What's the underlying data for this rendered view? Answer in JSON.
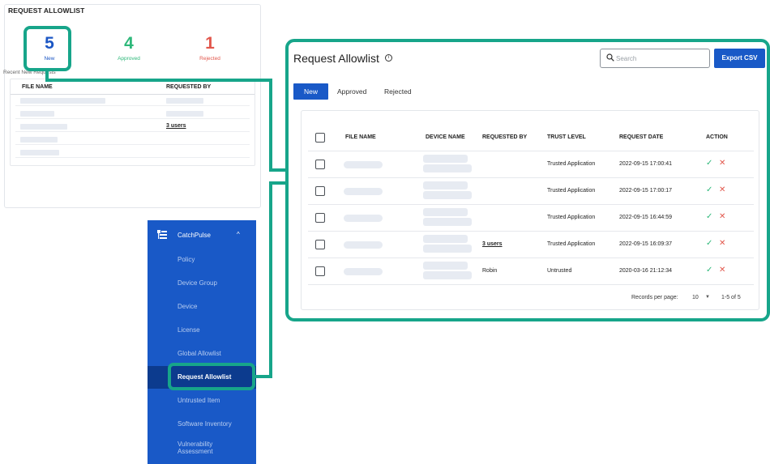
{
  "widget": {
    "title": "REQUEST ALLOWLIST",
    "stats": [
      {
        "count": "5",
        "label": "New"
      },
      {
        "count": "4",
        "label": "Approved"
      },
      {
        "count": "1",
        "label": "Rejected"
      }
    ],
    "recent_title": "Recent New Requests",
    "columns": [
      "FILE NAME",
      "REQUESTED BY"
    ],
    "row3_requested_by": "3 users"
  },
  "sidebar": {
    "header": "CatchPulse",
    "items": [
      {
        "label": "Policy"
      },
      {
        "label": "Device Group"
      },
      {
        "label": "Device"
      },
      {
        "label": "License"
      },
      {
        "label": "Global Allowlist"
      },
      {
        "label": "Request Allowlist"
      },
      {
        "label": "Untrusted Item"
      },
      {
        "label": "Software Inventory"
      },
      {
        "label": "Vulnerability Assessment"
      }
    ],
    "active_index": 5
  },
  "main": {
    "title": "Request Allowlist",
    "info_glyph": "i",
    "search_placeholder": "Search",
    "export_label": "Export CSV",
    "tabs": [
      "New",
      "Approved",
      "Rejected"
    ],
    "active_tab": "New",
    "columns": [
      "FILE NAME",
      "DEVICE NAME",
      "REQUESTED BY",
      "TRUST LEVEL",
      "REQUEST DATE",
      "ACTION"
    ],
    "rows": [
      {
        "requested_by": "",
        "trust_level": "Trusted Application",
        "request_date": "2022-09-15 17:00:41"
      },
      {
        "requested_by": "",
        "trust_level": "Trusted Application",
        "request_date": "2022-09-15 17:00:17"
      },
      {
        "requested_by": "",
        "trust_level": "Trusted Application",
        "request_date": "2022-09-15 16:44:59"
      },
      {
        "requested_by": "3 users",
        "trust_level": "Trusted Application",
        "request_date": "2022-09-15 16:09:37"
      },
      {
        "requested_by": "Robin",
        "trust_level": "Untrusted",
        "request_date": "2020-03-16 21:12:34"
      }
    ],
    "approve_glyph": "✓",
    "reject_glyph": "✕",
    "records_per_page_label": "Records per page:",
    "records_per_page": "10",
    "range": "1-5 of 5"
  },
  "colors": {
    "brand_blue": "#1959c7",
    "sidebar_active": "#0c3b8e",
    "highlight_green": "#17a58a",
    "approved_green": "#2eb87a",
    "rejected_red": "#e2574c"
  },
  "icons": {
    "sidebar_header": "list-tree-icon",
    "sidebar_chevron": "chevron-up-icon",
    "search": "search-icon",
    "approve": "check-icon",
    "reject": "close-icon",
    "pager_dropdown": "caret-down-icon"
  }
}
